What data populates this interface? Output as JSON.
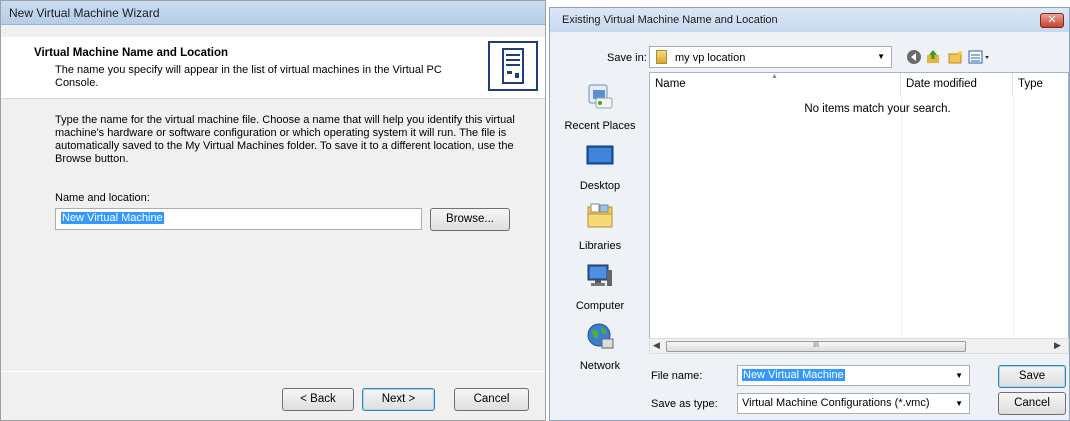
{
  "wizard": {
    "title": "New Virtual Machine Wizard",
    "header_title": "Virtual Machine Name and Location",
    "header_desc": "The name you specify will appear in the list of virtual machines in the Virtual PC Console.",
    "header_icon": "server-computer-icon",
    "body_text": "Type the name for the virtual machine file. Choose a name that will help you identify this virtual machine's hardware or software configuration or which operating system it will run. The file is automatically saved to the My Virtual Machines folder. To save it to a different location, use the Browse button.",
    "name_label": "Name and location:",
    "name_value": "New Virtual Machine",
    "browse_label": "Browse...",
    "back_label": "< Back",
    "next_label": "Next >",
    "cancel_label": "Cancel"
  },
  "dialog": {
    "title": "Existing Virtual Machine Name and Location",
    "close_glyph": "✕",
    "save_in_label": "Save in:",
    "save_in_value": "my vp location",
    "toolbar_icons": [
      "back-icon",
      "up-folder-icon",
      "new-folder-icon",
      "views-menu-icon"
    ],
    "places": [
      {
        "label": "Recent Places",
        "icon": "recent-places-icon"
      },
      {
        "label": "Desktop",
        "icon": "desktop-icon"
      },
      {
        "label": "Libraries",
        "icon": "libraries-icon"
      },
      {
        "label": "Computer",
        "icon": "computer-icon"
      },
      {
        "label": "Network",
        "icon": "network-icon"
      }
    ],
    "columns": [
      "Name",
      "Date modified",
      "Type"
    ],
    "empty_message": "No items match your search.",
    "scroll_thumb_grip": "III",
    "file_name_label": "File name:",
    "file_name_value": "New Virtual Machine",
    "save_as_type_label": "Save as type:",
    "save_as_type_value": "Virtual Machine Configurations (*.vmc)",
    "save_label": "Save",
    "cancel_label": "Cancel"
  },
  "colors": {
    "selection": "#3399ff",
    "title_bar": "#c9dcf1",
    "close_button": "#c7402c"
  }
}
